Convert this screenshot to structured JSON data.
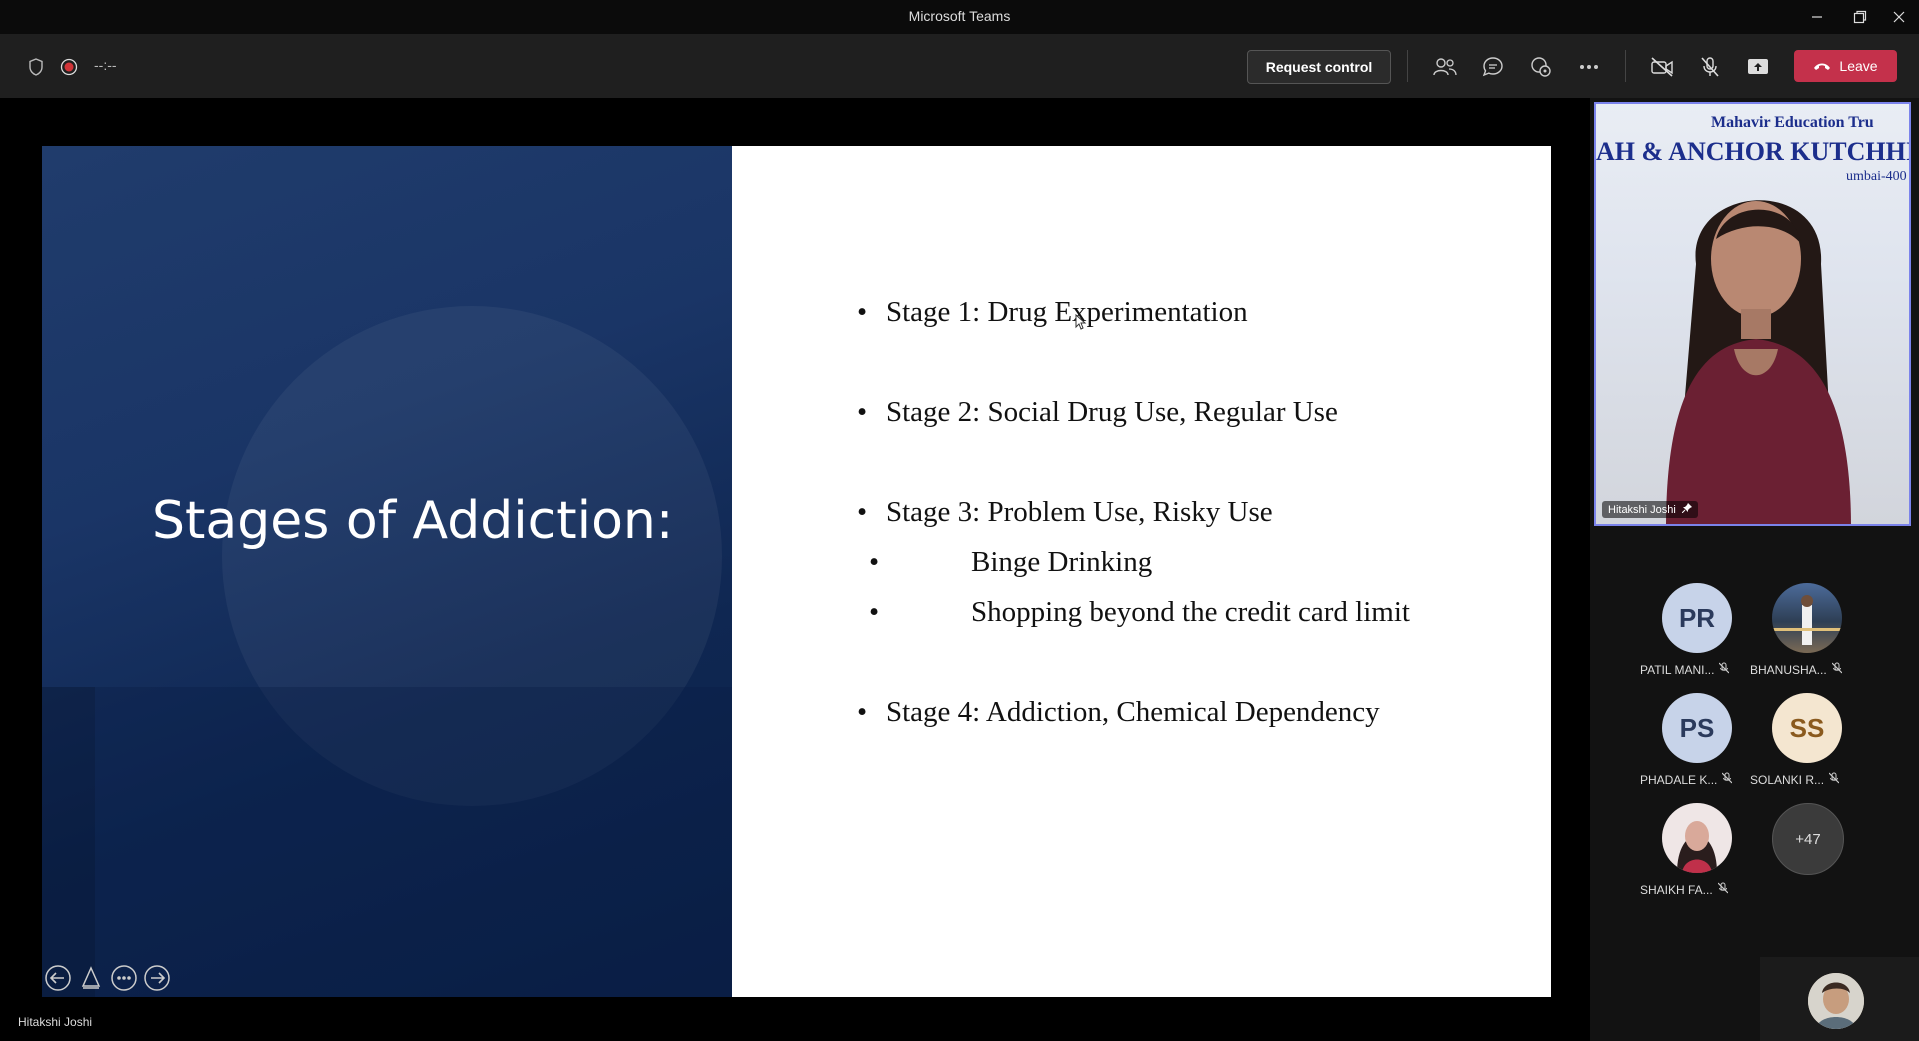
{
  "window": {
    "title": "Microsoft Teams"
  },
  "toolbar": {
    "timer": "--:--",
    "request_control_label": "Request control",
    "leave_label": "Leave",
    "leave_color": "#c4314b"
  },
  "slide": {
    "title": "Stages of Addiction:",
    "bullets": [
      {
        "text": "Stage 1: Drug Experimentation"
      },
      {
        "text": "Stage 2: Social Drug Use, Regular Use"
      },
      {
        "text": "Stage 3: Problem Use, Risky Use"
      },
      {
        "text": "Binge Drinking"
      },
      {
        "text": "Shopping beyond the credit card limit"
      },
      {
        "text": "Stage 4: Addiction, Chemical Dependency"
      }
    ],
    "bullet_glyph": "•"
  },
  "presenter": {
    "name": "Hitakshi Joshi"
  },
  "video": {
    "name": "Hitakshi Joshi",
    "banner_line1": "Mahavir Education Tru",
    "banner_line2": "AH & ANCHOR KUTCHHI EN",
    "banner_line3": "umbai-400"
  },
  "participants": [
    {
      "initials": "PR",
      "name": "PATIL MANI...",
      "avatar_color": "#c7d3e9"
    },
    {
      "initials": "",
      "name": "BHANUSHA...",
      "avatar_color": "#5a6f8a"
    },
    {
      "initials": "PS",
      "name": "PHADALE K...",
      "avatar_color": "#c7d3e9"
    },
    {
      "initials": "SS",
      "name": "SOLANKI R...",
      "avatar_color": "#f4e6d0"
    },
    {
      "initials": "",
      "name": "SHAIKH FA...",
      "avatar_color": "#e8d8d8"
    },
    {
      "initials": "+47",
      "name": "",
      "avatar_color": "#3b3b3b"
    }
  ],
  "colors": {
    "accent": "#7b83eb",
    "slide_blue": "#1a3566"
  }
}
